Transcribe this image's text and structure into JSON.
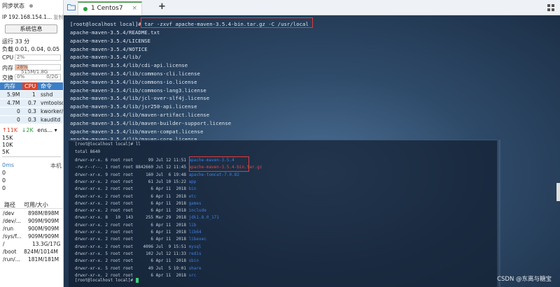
{
  "sidebar": {
    "sync_status": "同步状态",
    "ip_label": "IP 192.168.154.1...",
    "copy": "复制",
    "sysinfo_button": "系统信息",
    "uptime": "运行 33 分",
    "load": "负载 0.01, 0.04, 0.05",
    "cpu_label": "CPU",
    "cpu_value": "2%",
    "mem_label": "内存",
    "mem_percent": "28%",
    "mem_value": "515M/1.8G",
    "mem_fraction": 0.28,
    "swap_label": "交换",
    "swap_percent": "0%",
    "swap_value": "0/2G",
    "proc_headers": [
      "内存",
      "CPU",
      "命令"
    ],
    "processes": [
      {
        "mem": "5.9M",
        "cpu": "1",
        "cmd": "sshd"
      },
      {
        "mem": "4.7M",
        "cpu": "0.7",
        "cmd": "vmtoolsd"
      },
      {
        "mem": "0",
        "cpu": "0.3",
        "cmd": "kworker/"
      },
      {
        "mem": "0",
        "cpu": "0.3",
        "cmd": "kauditd"
      }
    ],
    "net_up": "↑11K",
    "net_down": "↓2K",
    "net_iface": "ens...",
    "net_scale": [
      "15K",
      "10K",
      "5K"
    ],
    "latency": "0ms",
    "latency_host": "本机",
    "latency_vals": [
      "0",
      "0",
      "0"
    ],
    "disk_headers": [
      "路径",
      "可用/大小"
    ],
    "disks": [
      {
        "path": "/dev",
        "size": "898M/898M"
      },
      {
        "path": "/dev/...",
        "size": "909M/909M"
      },
      {
        "path": "/run",
        "size": "900M/909M"
      },
      {
        "path": "/sys/f...",
        "size": "909M/909M"
      },
      {
        "path": "/",
        "size": "13.3G/17G"
      },
      {
        "path": "/boot",
        "size": "824M/1014M"
      },
      {
        "path": "/run/...",
        "size": "181M/181M"
      }
    ]
  },
  "tabbar": {
    "folder_icon": "folder-icon",
    "tab_label": "1 Centos7",
    "add": "+",
    "grid_icon": "grid-icon"
  },
  "terminal": {
    "command_prompt": "[root@localhost local]# ",
    "command": "tar -zxvf apache-maven-3.5.4-bin.tar.gz -C /usr/local",
    "output": [
      "apache-maven-3.5.4/README.txt",
      "apache-maven-3.5.4/LICENSE",
      "apache-maven-3.5.4/NOTICE",
      "apache-maven-3.5.4/lib/",
      "apache-maven-3.5.4/lib/cdi-api.license",
      "apache-maven-3.5.4/lib/commons-cli.license",
      "apache-maven-3.5.4/lib/commons-io.license",
      "apache-maven-3.5.4/lib/commons-lang3.license",
      "apache-maven-3.5.4/lib/jcl-over-slf4j.license",
      "apache-maven-3.5.4/lib/jsr250-api.license",
      "apache-maven-3.5.4/lib/maven-artifact.license",
      "apache-maven-3.5.4/lib/maven-builder-support.license",
      "apache-maven-3.5.4/lib/maven-compat.license",
      "apache-maven-3.5.4/lib/maven-core.license"
    ],
    "ll_prompt": "[root@localhost local]# ll",
    "total": "total 8640",
    "listing": [
      {
        "meta": "drwxr-xr-x. 6 root root      99 Jul 12 11:51 ",
        "name": "apache-maven-3.5.4",
        "kind": "dirname"
      },
      {
        "meta": "-rw-r--r--. 1 root root 8842660 Jul 12 11:45 ",
        "name": "apache-maven-3.5.4-bin.tar.gz",
        "kind": "red"
      },
      {
        "meta": "drwxr-xr-x. 9 root root     160 Jul  6 19:48 ",
        "name": "apache-tomcat-7.0.82",
        "kind": "dirname"
      },
      {
        "meta": "drwxr-xr-x. 2 root root      61 Jul 10 15:22 ",
        "name": "app",
        "kind": "dirname"
      },
      {
        "meta": "drwxr-xr-x. 2 root root       6 Apr 11  2018 ",
        "name": "bin",
        "kind": "dirname"
      },
      {
        "meta": "drwxr-xr-x. 2 root root       6 Apr 11  2018 ",
        "name": "etc",
        "kind": "dirname"
      },
      {
        "meta": "drwxr-xr-x. 2 root root       6 Apr 11  2018 ",
        "name": "games",
        "kind": "dirname"
      },
      {
        "meta": "drwxr-xr-x. 2 root root       6 Apr 11  2018 ",
        "name": "include",
        "kind": "dirname"
      },
      {
        "meta": "drwxr-xr-x. 8   10  143     255 Mar 29  2018 ",
        "name": "jdk1.8.0_171",
        "kind": "dirname"
      },
      {
        "meta": "drwxr-xr-x. 2 root root       6 Apr 11  2018 ",
        "name": "lib",
        "kind": "dirname"
      },
      {
        "meta": "drwxr-xr-x. 2 root root       6 Apr 11  2018 ",
        "name": "lib64",
        "kind": "dirname"
      },
      {
        "meta": "drwxr-xr-x. 2 root root       6 Apr 11  2018 ",
        "name": "libexec",
        "kind": "dirname"
      },
      {
        "meta": "drwxr-xr-x. 2 root root    4096 Jul  9 15:51 ",
        "name": "mysql",
        "kind": "dirname"
      },
      {
        "meta": "drwxr-xr-x. 5 root root     102 Jul 12 11:33 ",
        "name": "redis",
        "kind": "dirname"
      },
      {
        "meta": "drwxr-xr-x. 2 root root       6 Apr 11  2018 ",
        "name": "sbin",
        "kind": "dirname"
      },
      {
        "meta": "drwxr-xr-x. 5 root root      49 Jul  5 19:01 ",
        "name": "share",
        "kind": "dirname"
      },
      {
        "meta": "drwxr-xr-x. 2 root root       6 Apr 11  2018 ",
        "name": "src",
        "kind": "dirname"
      }
    ],
    "final_prompt": "[root@localhost local]# "
  },
  "watermark": "CSDN @东离与糖宝",
  "colors": {
    "accent_tab": "#5da25d",
    "highlight_box": "#e03b3b",
    "proc_header": "#3d7fc6"
  }
}
